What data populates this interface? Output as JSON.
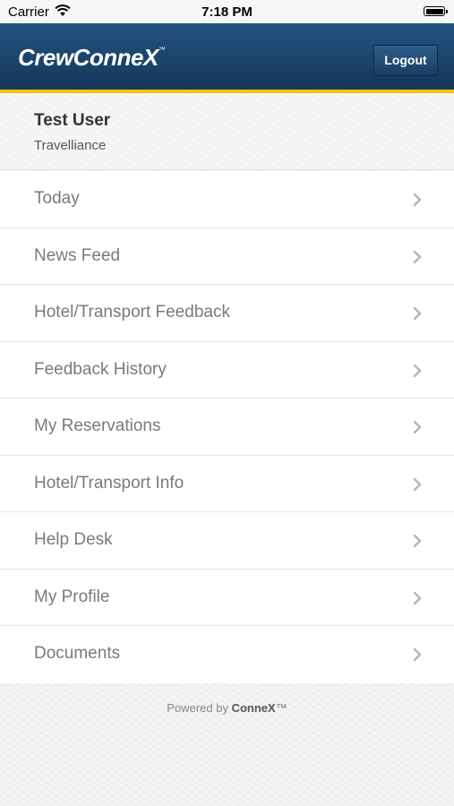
{
  "status_bar": {
    "carrier": "Carrier",
    "time": "7:18 PM"
  },
  "header": {
    "logo_text": "CrewConneX",
    "logo_tm": "™",
    "logout_label": "Logout",
    "brand_color": "#1c4570",
    "stripe_color": "#f2c500"
  },
  "user": {
    "name": "Test User",
    "company": "Travelliance"
  },
  "menu": {
    "items": [
      {
        "label": "Today",
        "icon": "chevron-right-icon"
      },
      {
        "label": "News Feed",
        "icon": "chevron-right-icon"
      },
      {
        "label": "Hotel/Transport Feedback",
        "icon": "chevron-right-icon"
      },
      {
        "label": "Feedback History",
        "icon": "chevron-right-icon"
      },
      {
        "label": "My Reservations",
        "icon": "chevron-right-icon"
      },
      {
        "label": "Hotel/Transport Info",
        "icon": "chevron-right-icon"
      },
      {
        "label": "Help Desk",
        "icon": "chevron-right-icon"
      },
      {
        "label": "My Profile",
        "icon": "chevron-right-icon"
      },
      {
        "label": "Documents",
        "icon": "chevron-right-icon"
      }
    ]
  },
  "footer": {
    "powered_prefix": "Powered by ",
    "powered_brand": "ConneX",
    "powered_tm": "™"
  }
}
